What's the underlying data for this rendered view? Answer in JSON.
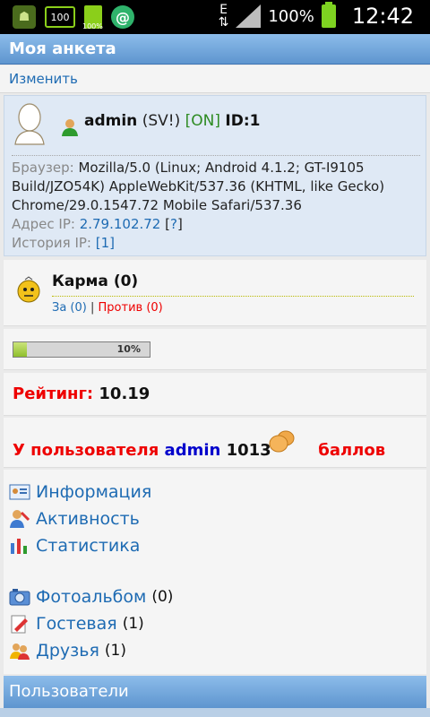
{
  "statusbar": {
    "battery_small": "100",
    "network": "E",
    "battery_percent": "100%",
    "time": "12:42"
  },
  "title": "Моя анкета",
  "edit_link": "Изменить",
  "profile": {
    "username": "admin",
    "status": "(SV!)",
    "online": "[ON]",
    "id": "ID:1",
    "browser_label": "Браузер:",
    "browser_value": "Mozilla/5.0 (Linux; Android 4.1.2; GT-I9105 Build/JZO54K) AppleWebKit/537.36 (KHTML, like Gecko) Chrome/29.0.1547.72 Mobile Safari/537.36",
    "ip_label": "Адрес IP:",
    "ip_value": "2.79.102.72",
    "ip_help": "?",
    "history_label": "История IP:",
    "history_value": "1"
  },
  "karma": {
    "title": "Карма (0)",
    "for_label": "За (0)",
    "separator": "|",
    "against_label": "Против (0)"
  },
  "progress": {
    "value_pct": 10,
    "label": "10%"
  },
  "rating": {
    "label": "Рейтинг:",
    "value": "10.19"
  },
  "points": {
    "prefix": "У пользователя",
    "username": "admin",
    "amount": "1013",
    "suffix": "баллов"
  },
  "menu": [
    {
      "label": "Информация",
      "icon": "info-card-icon"
    },
    {
      "label": "Активность",
      "icon": "activity-icon"
    },
    {
      "label": "Статистика",
      "icon": "stats-chart-icon"
    },
    {
      "label": "Фотоальбом",
      "count": "(0)",
      "icon": "photo-album-icon"
    },
    {
      "label": "Гостевая",
      "count": "(1)",
      "icon": "guestbook-icon"
    },
    {
      "label": "Друзья",
      "count": "(1)",
      "icon": "friends-icon"
    }
  ],
  "bottom_bar": "Пользователи"
}
